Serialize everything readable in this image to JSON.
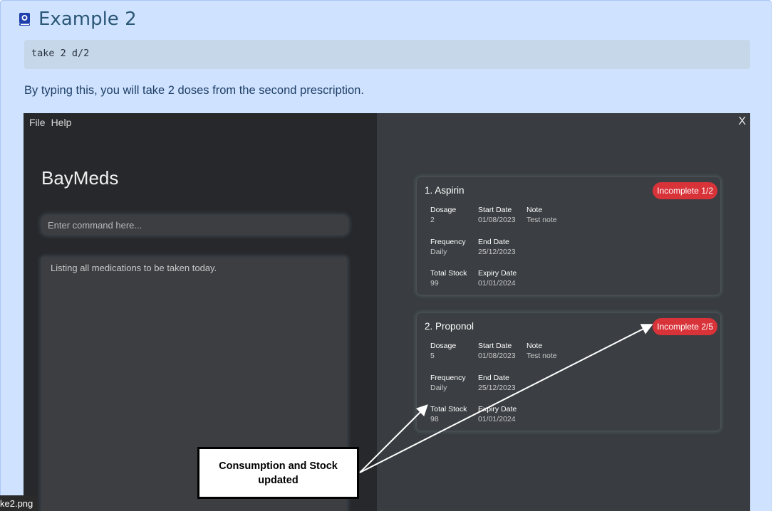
{
  "section": {
    "heading": "Example 2",
    "heading_icon": "book-icon",
    "command": "take 2 d/2",
    "description": "By typing this, you will take 2 doses from the second prescription."
  },
  "app": {
    "menu": [
      "File",
      "Help"
    ],
    "close_label": "X",
    "title": "BayMeds",
    "command_placeholder": "Enter command here...",
    "result_text": "Listing all medications to be taken today.",
    "colors": {
      "left_pane": "#26282b",
      "right_pane": "#393d41",
      "badge": "#d9333a"
    }
  },
  "cards": [
    {
      "title": "1.  Aspirin",
      "status": "Incomplete 1/2",
      "fields": {
        "dosage_label": "Dosage",
        "dosage": "2",
        "start_label": "Start Date",
        "start": "01/08/2023",
        "note_label": "Note",
        "note": "Test note",
        "frequency_label": "Frequency",
        "frequency": "Daily",
        "end_label": "End Date",
        "end": "25/12/2023",
        "stock_label": "Total Stock",
        "stock": "99",
        "expiry_label": "Expiry Date",
        "expiry": "01/01/2024"
      }
    },
    {
      "title": "2.  Proponol",
      "status": "Incomplete 2/5",
      "fields": {
        "dosage_label": "Dosage",
        "dosage": "5",
        "start_label": "Start Date",
        "start": "01/08/2023",
        "note_label": "Note",
        "note": "Test note",
        "frequency_label": "Frequency",
        "frequency": "Daily",
        "end_label": "End Date",
        "end": "25/12/2023",
        "stock_label": "Total Stock",
        "stock": "98",
        "expiry_label": "Expiry Date",
        "expiry": "01/01/2024"
      }
    }
  ],
  "annotation": {
    "text": "Consumption and Stock updated"
  },
  "file_label": "ke2.png"
}
